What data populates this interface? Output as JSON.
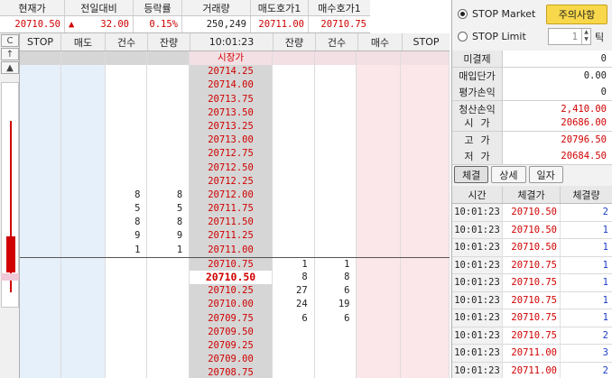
{
  "summary": {
    "headers": [
      "현재가",
      "전일대비",
      "등락률",
      "거래량",
      "매도호가1",
      "매수호가1"
    ],
    "current_price": "20710.50",
    "change_arrow": "▲",
    "change": "32.00",
    "change_rate": "0.15%",
    "volume": "250,249",
    "ask1": "20711.00",
    "bid1": "20710.75"
  },
  "strip": {
    "c_label": "C",
    "up_label": "↑",
    "tri_label": "▲"
  },
  "book": {
    "headers": [
      "STOP",
      "매도",
      "건수",
      "잔량",
      "10:01:23",
      "잔량",
      "건수",
      "매수",
      "STOP"
    ],
    "market_label": "시장가",
    "rows": [
      {
        "price": "20714.25",
        "cnt": "",
        "rem": "",
        "rem2": "",
        "cnt2": ""
      },
      {
        "price": "20714.00",
        "cnt": "",
        "rem": "",
        "rem2": "",
        "cnt2": ""
      },
      {
        "price": "20713.75",
        "cnt": "",
        "rem": "",
        "rem2": "",
        "cnt2": ""
      },
      {
        "price": "20713.50",
        "cnt": "",
        "rem": "",
        "rem2": "",
        "cnt2": ""
      },
      {
        "price": "20713.25",
        "cnt": "",
        "rem": "",
        "rem2": "",
        "cnt2": ""
      },
      {
        "price": "20713.00",
        "cnt": "",
        "rem": "",
        "rem2": "",
        "cnt2": ""
      },
      {
        "price": "20712.75",
        "cnt": "",
        "rem": "",
        "rem2": "",
        "cnt2": ""
      },
      {
        "price": "20712.50",
        "cnt": "",
        "rem": "",
        "rem2": "",
        "cnt2": ""
      },
      {
        "price": "20712.25",
        "cnt": "",
        "rem": "",
        "rem2": "",
        "cnt2": ""
      },
      {
        "price": "20712.00",
        "cnt": "8",
        "rem": "8",
        "rem2": "",
        "cnt2": ""
      },
      {
        "price": "20711.75",
        "cnt": "5",
        "rem": "5",
        "rem2": "",
        "cnt2": ""
      },
      {
        "price": "20711.50",
        "cnt": "8",
        "rem": "8",
        "rem2": "",
        "cnt2": ""
      },
      {
        "price": "20711.25",
        "cnt": "9",
        "rem": "9",
        "rem2": "",
        "cnt2": ""
      },
      {
        "price": "20711.00",
        "cnt": "1",
        "rem": "1",
        "rem2": "",
        "cnt2": ""
      },
      {
        "price": "20710.75",
        "cnt": "",
        "rem": "",
        "rem2": "1",
        "cnt2": "1"
      },
      {
        "price": "20710.50",
        "cnt": "",
        "rem": "",
        "rem2": "8",
        "cnt2": "8",
        "current": true
      },
      {
        "price": "20710.25",
        "cnt": "",
        "rem": "",
        "rem2": "27",
        "cnt2": "6"
      },
      {
        "price": "20710.00",
        "cnt": "",
        "rem": "",
        "rem2": "24",
        "cnt2": "19"
      },
      {
        "price": "20709.75",
        "cnt": "",
        "rem": "",
        "rem2": "6",
        "cnt2": "6"
      },
      {
        "price": "20709.50",
        "cnt": "",
        "rem": "",
        "rem2": "",
        "cnt2": ""
      },
      {
        "price": "20709.25",
        "cnt": "",
        "rem": "",
        "rem2": "",
        "cnt2": ""
      },
      {
        "price": "20709.00",
        "cnt": "",
        "rem": "",
        "rem2": "",
        "cnt2": ""
      },
      {
        "price": "20708.75",
        "cnt": "",
        "rem": "",
        "rem2": "",
        "cnt2": ""
      }
    ]
  },
  "panel": {
    "stop_market": "STOP Market",
    "stop_limit": "STOP Limit",
    "notice": "주의사항",
    "tick_value": "1",
    "tick_label": "틱",
    "info": [
      {
        "k": "미결제",
        "v": "0"
      },
      {
        "k": "매입단가",
        "v": "0.00"
      },
      {
        "k": "평가손익",
        "v": "0"
      },
      {
        "k": "청산손익",
        "v": "2,410.00"
      }
    ],
    "ohlc": [
      {
        "k": "시가",
        "v": "20686.00"
      },
      {
        "k": "고가",
        "v": "20796.50"
      },
      {
        "k": "저가",
        "v": "20684.50"
      }
    ],
    "tabs": [
      "체결",
      "상세",
      "일자"
    ],
    "tick_headers": [
      "시간",
      "체결가",
      "체결량"
    ],
    "ticks": [
      {
        "t": "10:01:23",
        "p": "20710.50",
        "q": "2"
      },
      {
        "t": "10:01:23",
        "p": "20710.50",
        "q": "1"
      },
      {
        "t": "10:01:23",
        "p": "20710.50",
        "q": "1"
      },
      {
        "t": "10:01:23",
        "p": "20710.75",
        "q": "1"
      },
      {
        "t": "10:01:23",
        "p": "20710.75",
        "q": "1"
      },
      {
        "t": "10:01:23",
        "p": "20710.75",
        "q": "1"
      },
      {
        "t": "10:01:23",
        "p": "20710.75",
        "q": "1"
      },
      {
        "t": "10:01:23",
        "p": "20710.75",
        "q": "2"
      },
      {
        "t": "10:01:23",
        "p": "20711.00",
        "q": "3"
      },
      {
        "t": "10:01:23",
        "p": "20711.00",
        "q": "2"
      }
    ]
  },
  "colors": {
    "up": "#d00000",
    "down": "#1a3cc8",
    "ask_bg": "#fbe6ea",
    "bid_bg": "#e6f0fb",
    "notice_bg": "#f8d84a"
  }
}
